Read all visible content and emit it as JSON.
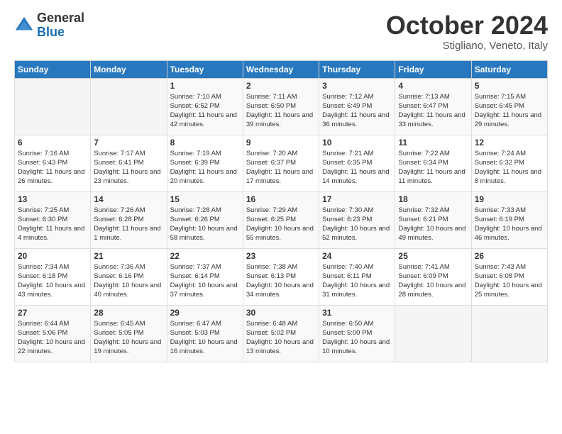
{
  "logo": {
    "general": "General",
    "blue": "Blue"
  },
  "title": "October 2024",
  "location": "Stigliano, Veneto, Italy",
  "days_of_week": [
    "Sunday",
    "Monday",
    "Tuesday",
    "Wednesday",
    "Thursday",
    "Friday",
    "Saturday"
  ],
  "weeks": [
    [
      {
        "day": "",
        "sunrise": "",
        "sunset": "",
        "daylight": ""
      },
      {
        "day": "",
        "sunrise": "",
        "sunset": "",
        "daylight": ""
      },
      {
        "day": "1",
        "sunrise": "Sunrise: 7:10 AM",
        "sunset": "Sunset: 6:52 PM",
        "daylight": "Daylight: 11 hours and 42 minutes."
      },
      {
        "day": "2",
        "sunrise": "Sunrise: 7:11 AM",
        "sunset": "Sunset: 6:50 PM",
        "daylight": "Daylight: 11 hours and 39 minutes."
      },
      {
        "day": "3",
        "sunrise": "Sunrise: 7:12 AM",
        "sunset": "Sunset: 6:49 PM",
        "daylight": "Daylight: 11 hours and 36 minutes."
      },
      {
        "day": "4",
        "sunrise": "Sunrise: 7:13 AM",
        "sunset": "Sunset: 6:47 PM",
        "daylight": "Daylight: 11 hours and 33 minutes."
      },
      {
        "day": "5",
        "sunrise": "Sunrise: 7:15 AM",
        "sunset": "Sunset: 6:45 PM",
        "daylight": "Daylight: 11 hours and 29 minutes."
      }
    ],
    [
      {
        "day": "6",
        "sunrise": "Sunrise: 7:16 AM",
        "sunset": "Sunset: 6:43 PM",
        "daylight": "Daylight: 11 hours and 26 minutes."
      },
      {
        "day": "7",
        "sunrise": "Sunrise: 7:17 AM",
        "sunset": "Sunset: 6:41 PM",
        "daylight": "Daylight: 11 hours and 23 minutes."
      },
      {
        "day": "8",
        "sunrise": "Sunrise: 7:19 AM",
        "sunset": "Sunset: 6:39 PM",
        "daylight": "Daylight: 11 hours and 20 minutes."
      },
      {
        "day": "9",
        "sunrise": "Sunrise: 7:20 AM",
        "sunset": "Sunset: 6:37 PM",
        "daylight": "Daylight: 11 hours and 17 minutes."
      },
      {
        "day": "10",
        "sunrise": "Sunrise: 7:21 AM",
        "sunset": "Sunset: 6:35 PM",
        "daylight": "Daylight: 11 hours and 14 minutes."
      },
      {
        "day": "11",
        "sunrise": "Sunrise: 7:22 AM",
        "sunset": "Sunset: 6:34 PM",
        "daylight": "Daylight: 11 hours and 11 minutes."
      },
      {
        "day": "12",
        "sunrise": "Sunrise: 7:24 AM",
        "sunset": "Sunset: 6:32 PM",
        "daylight": "Daylight: 11 hours and 8 minutes."
      }
    ],
    [
      {
        "day": "13",
        "sunrise": "Sunrise: 7:25 AM",
        "sunset": "Sunset: 6:30 PM",
        "daylight": "Daylight: 11 hours and 4 minutes."
      },
      {
        "day": "14",
        "sunrise": "Sunrise: 7:26 AM",
        "sunset": "Sunset: 6:28 PM",
        "daylight": "Daylight: 11 hours and 1 minute."
      },
      {
        "day": "15",
        "sunrise": "Sunrise: 7:28 AM",
        "sunset": "Sunset: 6:26 PM",
        "daylight": "Daylight: 10 hours and 58 minutes."
      },
      {
        "day": "16",
        "sunrise": "Sunrise: 7:29 AM",
        "sunset": "Sunset: 6:25 PM",
        "daylight": "Daylight: 10 hours and 55 minutes."
      },
      {
        "day": "17",
        "sunrise": "Sunrise: 7:30 AM",
        "sunset": "Sunset: 6:23 PM",
        "daylight": "Daylight: 10 hours and 52 minutes."
      },
      {
        "day": "18",
        "sunrise": "Sunrise: 7:32 AM",
        "sunset": "Sunset: 6:21 PM",
        "daylight": "Daylight: 10 hours and 49 minutes."
      },
      {
        "day": "19",
        "sunrise": "Sunrise: 7:33 AM",
        "sunset": "Sunset: 6:19 PM",
        "daylight": "Daylight: 10 hours and 46 minutes."
      }
    ],
    [
      {
        "day": "20",
        "sunrise": "Sunrise: 7:34 AM",
        "sunset": "Sunset: 6:18 PM",
        "daylight": "Daylight: 10 hours and 43 minutes."
      },
      {
        "day": "21",
        "sunrise": "Sunrise: 7:36 AM",
        "sunset": "Sunset: 6:16 PM",
        "daylight": "Daylight: 10 hours and 40 minutes."
      },
      {
        "day": "22",
        "sunrise": "Sunrise: 7:37 AM",
        "sunset": "Sunset: 6:14 PM",
        "daylight": "Daylight: 10 hours and 37 minutes."
      },
      {
        "day": "23",
        "sunrise": "Sunrise: 7:38 AM",
        "sunset": "Sunset: 6:13 PM",
        "daylight": "Daylight: 10 hours and 34 minutes."
      },
      {
        "day": "24",
        "sunrise": "Sunrise: 7:40 AM",
        "sunset": "Sunset: 6:11 PM",
        "daylight": "Daylight: 10 hours and 31 minutes."
      },
      {
        "day": "25",
        "sunrise": "Sunrise: 7:41 AM",
        "sunset": "Sunset: 6:09 PM",
        "daylight": "Daylight: 10 hours and 28 minutes."
      },
      {
        "day": "26",
        "sunrise": "Sunrise: 7:43 AM",
        "sunset": "Sunset: 6:08 PM",
        "daylight": "Daylight: 10 hours and 25 minutes."
      }
    ],
    [
      {
        "day": "27",
        "sunrise": "Sunrise: 6:44 AM",
        "sunset": "Sunset: 5:06 PM",
        "daylight": "Daylight: 10 hours and 22 minutes."
      },
      {
        "day": "28",
        "sunrise": "Sunrise: 6:45 AM",
        "sunset": "Sunset: 5:05 PM",
        "daylight": "Daylight: 10 hours and 19 minutes."
      },
      {
        "day": "29",
        "sunrise": "Sunrise: 6:47 AM",
        "sunset": "Sunset: 5:03 PM",
        "daylight": "Daylight: 10 hours and 16 minutes."
      },
      {
        "day": "30",
        "sunrise": "Sunrise: 6:48 AM",
        "sunset": "Sunset: 5:02 PM",
        "daylight": "Daylight: 10 hours and 13 minutes."
      },
      {
        "day": "31",
        "sunrise": "Sunrise: 6:50 AM",
        "sunset": "Sunset: 5:00 PM",
        "daylight": "Daylight: 10 hours and 10 minutes."
      },
      {
        "day": "",
        "sunrise": "",
        "sunset": "",
        "daylight": ""
      },
      {
        "day": "",
        "sunrise": "",
        "sunset": "",
        "daylight": ""
      }
    ]
  ]
}
